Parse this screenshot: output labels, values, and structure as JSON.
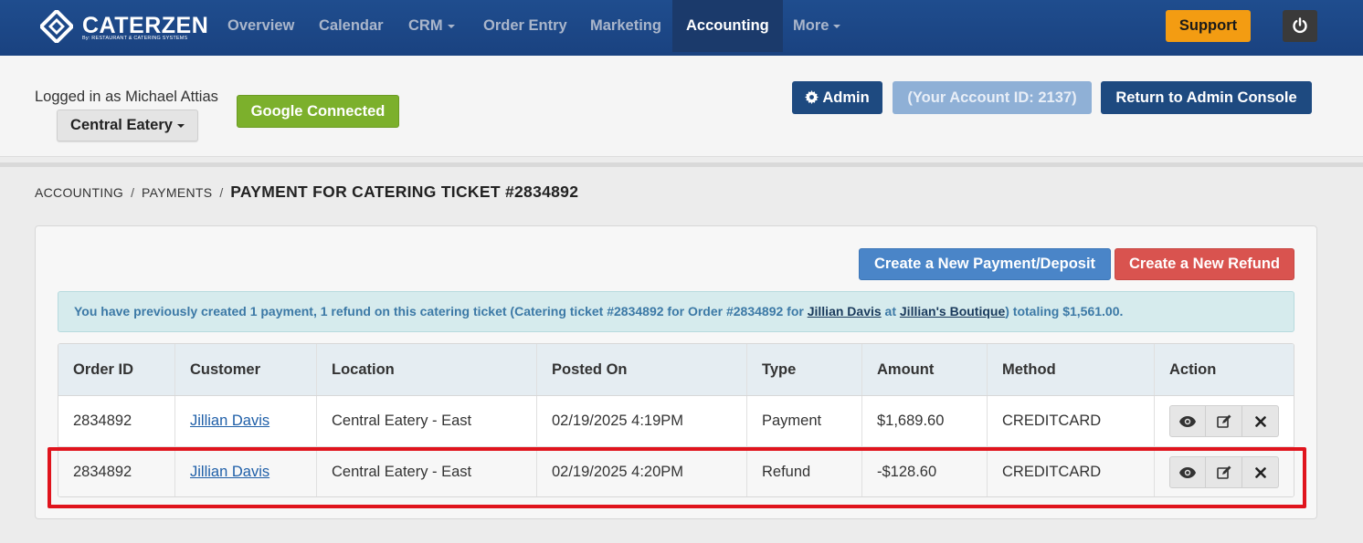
{
  "brand": {
    "name": "CATERZEN",
    "tagline": "By: RESTAURANT & CATERING SYSTEMS"
  },
  "nav": {
    "items": [
      {
        "label": "Overview"
      },
      {
        "label": "Calendar"
      },
      {
        "label": "CRM"
      },
      {
        "label": "Order Entry"
      },
      {
        "label": "Marketing"
      },
      {
        "label": "Accounting"
      },
      {
        "label": "More"
      }
    ],
    "support_label": "Support"
  },
  "subheader": {
    "logged_in": "Logged in as Michael Attias",
    "location_selector": "Central Eatery",
    "google_label": "Google Connected",
    "admin_label": "Admin",
    "account_id_label": "(Your Account ID: 2137)",
    "return_label": "Return to Admin Console"
  },
  "breadcrumb": {
    "items": [
      "ACCOUNTING",
      "PAYMENTS"
    ],
    "separator": "/",
    "current": "PAYMENT FOR CATERING TICKET #2834892"
  },
  "actions": {
    "create_payment": "Create a New Payment/Deposit",
    "create_refund": "Create a New Refund"
  },
  "info": {
    "prefix": "You have previously created 1 payment, 1 refund on this catering ticket (Catering ticket #2834892 for Order #2834892 for ",
    "customer": "Jillian Davis",
    "at": " at ",
    "company": "Jillian's Boutique",
    "suffix": ") totaling $1,561.00."
  },
  "table": {
    "headers": [
      "Order ID",
      "Customer",
      "Location",
      "Posted On",
      "Type",
      "Amount",
      "Method",
      "Action"
    ],
    "rows": [
      {
        "order_id": "2834892",
        "customer": "Jillian Davis",
        "location": "Central Eatery - East",
        "posted_on": "02/19/2025 4:19PM",
        "type": "Payment",
        "amount": "$1,689.60",
        "method": "CREDITCARD"
      },
      {
        "order_id": "2834892",
        "customer": "Jillian Davis",
        "location": "Central Eatery - East",
        "posted_on": "02/19/2025 4:20PM",
        "type": "Refund",
        "amount": "-$128.60",
        "method": "CREDITCARD"
      }
    ]
  },
  "colors": {
    "nav_bg": "#1f4d8e",
    "support": "#f39c12",
    "google": "#7cb02c",
    "primary": "#1e4a80",
    "info_bg": "#d6ebed",
    "refund_btn": "#d9534f",
    "highlight": "#e0141d"
  },
  "icons": {
    "logo": "caterzen-diamond-logo",
    "power": "power-icon",
    "gear": "gear-icon",
    "view": "eye-icon",
    "edit": "edit-icon",
    "delete": "close-icon"
  }
}
